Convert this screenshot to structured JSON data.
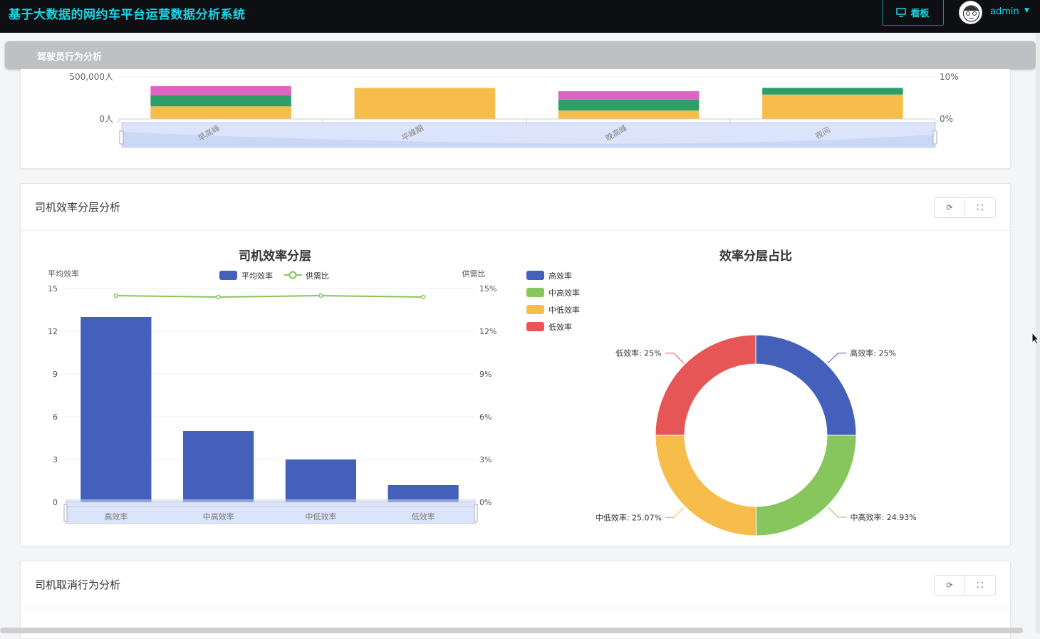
{
  "header": {
    "app_title": "基于大数据的网约车平台运营数据分析系统",
    "board_button_label": "看板",
    "user_name": "admin"
  },
  "subnav": {
    "title": "驾驶员行为分析"
  },
  "top_chart": {
    "y_left_ticks": [
      "500,000人",
      "0人"
    ],
    "y_right_ticks": [
      "10%",
      "0%"
    ],
    "categories": [
      "早高峰",
      "平峰期",
      "晚高峰",
      "夜间"
    ]
  },
  "efficiency_card": {
    "title": "司机效率分层分析",
    "refresh_icon": "refresh-icon",
    "fullscreen_icon": "fullscreen-icon"
  },
  "cancel_card": {
    "title": "司机取消行为分析"
  },
  "chart_data": [
    {
      "type": "bar",
      "title": "",
      "categories": [
        "早高峰",
        "平峰期",
        "晚高峰",
        "夜间"
      ],
      "series": [
        {
          "values": [
            150000,
            0,
            100000,
            0
          ],
          "color": "#f6bd4b"
        },
        {
          "values": [
            130000,
            0,
            130000,
            0
          ],
          "color": "#2e9e68"
        },
        {
          "values": [
            110000,
            0,
            100000,
            0
          ],
          "color": "#e063c4"
        },
        {
          "values": [
            0,
            370000,
            0,
            290000
          ],
          "color": "#f6bd4b"
        },
        {
          "values": [
            0,
            0,
            0,
            80000
          ],
          "color": "#2e9e68"
        }
      ],
      "ylim": [
        0,
        500000
      ],
      "y2lim": [
        0,
        10
      ]
    },
    {
      "type": "bar",
      "title": "司机效率分层",
      "xlabel": "",
      "ylabel": "平均效率",
      "y2label": "供需比",
      "categories": [
        "高效率",
        "中高效率",
        "中低效率",
        "低效率"
      ],
      "series": [
        {
          "name": "平均效率",
          "type": "bar",
          "values": [
            13,
            5,
            3,
            1.2
          ],
          "color": "#4560bb"
        },
        {
          "name": "供需比",
          "type": "line",
          "axis": "right",
          "values": [
            14.5,
            14.4,
            14.5,
            14.4
          ],
          "color": "#86c65c"
        }
      ],
      "ylim": [
        0,
        15
      ],
      "y_ticks": [
        "0",
        "3",
        "6",
        "9",
        "12",
        "15"
      ],
      "y2lim": [
        0,
        15
      ],
      "y2_ticks": [
        "0%",
        "3%",
        "6%",
        "9%",
        "12%",
        "15%"
      ],
      "legend": "top-center"
    },
    {
      "type": "pie",
      "title": "效率分层占比",
      "categories": [
        "高效率",
        "中高效率",
        "中低效率",
        "低效率"
      ],
      "values": [
        25,
        24.93,
        25.07,
        25
      ],
      "labels": [
        "高效率: 25%",
        "中高效率: 24.93%",
        "中低效率: 25.07%",
        "低效率: 25%"
      ],
      "colors": [
        "#4560bb",
        "#86c65c",
        "#f6bd4b",
        "#e65656"
      ],
      "legend": "top-left"
    }
  ]
}
